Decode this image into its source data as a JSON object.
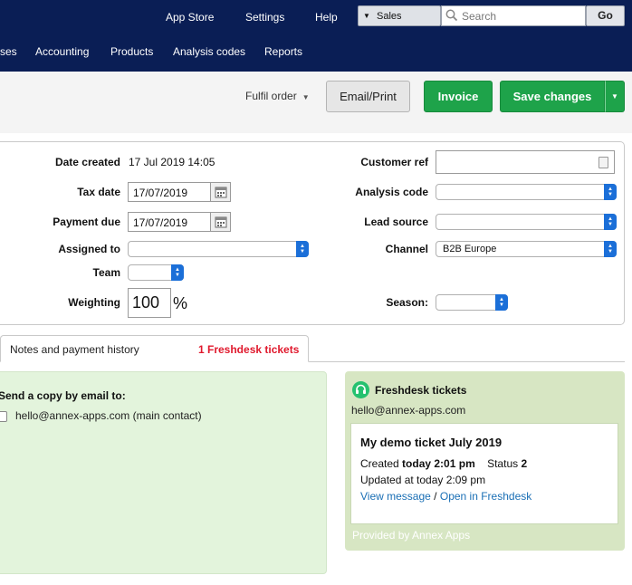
{
  "topbar": {
    "links": {
      "app_store": "App Store",
      "settings": "Settings",
      "help": "Help"
    },
    "search": {
      "scope": "Sales",
      "placeholder": "Search",
      "go_label": "Go"
    },
    "nav": {
      "partial_item": "ses",
      "accounting": "Accounting",
      "products": "Products",
      "analysis_codes": "Analysis codes",
      "reports": "Reports"
    }
  },
  "toolbar": {
    "fulfil_order": "Fulfil order",
    "email_print": "Email/Print",
    "invoice": "Invoice",
    "save_changes": "Save changes"
  },
  "form": {
    "date_created_label": "Date created",
    "date_created_value": "17 Jul 2019 14:05",
    "tax_date_label": "Tax date",
    "tax_date_value": "17/07/2019",
    "payment_due_label": "Payment due",
    "payment_due_value": "17/07/2019",
    "assigned_to_label": "Assigned to",
    "assigned_to_value": "",
    "team_label": "Team",
    "team_value": "",
    "weighting_label": "Weighting",
    "weighting_value": "100",
    "weighting_unit": "%",
    "customer_ref_label": "Customer ref",
    "customer_ref_value": "",
    "analysis_code_label": "Analysis code",
    "analysis_code_value": "",
    "lead_source_label": "Lead source",
    "lead_source_value": "",
    "channel_label": "Channel",
    "channel_value": "B2B Europe",
    "season_label": "Season:",
    "season_value": ""
  },
  "tabs": {
    "notes": "Notes and payment history",
    "freshdesk": "1 Freshdesk tickets"
  },
  "email_copy": {
    "heading": "Send a copy by email to:",
    "contact": "hello@annex-apps.com (main contact)",
    "checked": false
  },
  "freshdesk": {
    "title": "Freshdesk tickets",
    "email": "hello@annex-apps.com",
    "ticket": {
      "title": "My demo ticket July 2019",
      "created_label": "Created",
      "created_value": "today 2:01 pm",
      "status_label": "Status",
      "status_value": "2",
      "updated": "Updated at today 2:09 pm",
      "view_message": "View message",
      "separator": "/",
      "open_in": "Open in Freshdesk"
    },
    "provided_by": "Provided by Annex Apps"
  },
  "colors": {
    "nav_bg": "#0a1e55",
    "primary_green": "#1ea34a",
    "select_arrow": "#1b6fd8",
    "freshdesk_tab_red": "#e0192d",
    "left_panel_bg": "#e3f4dc",
    "right_panel_bg": "#d7e6c3",
    "link": "#1a6fb5"
  },
  "icons": [
    "chevron-down-icon",
    "search-icon",
    "calendar-icon",
    "contact-card-icon",
    "headset-icon",
    "select-arrows-icon"
  ]
}
